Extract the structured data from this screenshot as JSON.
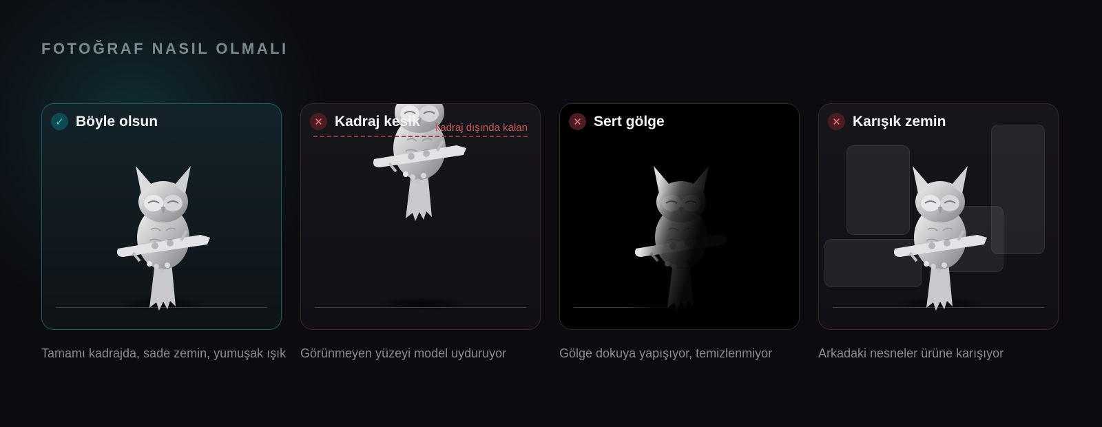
{
  "section_title": "FOTOĞRAF NASIL OLMALI",
  "cards": [
    {
      "title": "Böyle olsun",
      "caption": "Tamamı kadrajda, sade zemin, yumuşak ışık",
      "status": "ok",
      "icon": "check-icon",
      "glyph": "✓"
    },
    {
      "title": "Kadraj kesik",
      "caption": "Görünmeyen yüzeyi model uyduruyor",
      "status": "bad",
      "icon": "close-icon",
      "glyph": "✕",
      "annotation": "kadraj dışında kalan"
    },
    {
      "title": "Sert gölge",
      "caption": "Gölge dokuya yapışıyor, temizlenmiyor",
      "status": "bad",
      "icon": "close-icon",
      "glyph": "✕"
    },
    {
      "title": "Karışık zemin",
      "caption": "Arkadaki nesneler ürüne karışıyor",
      "status": "bad",
      "icon": "close-icon",
      "glyph": "✕"
    }
  ],
  "colors": {
    "ok_accent": "#4fd0d8",
    "bad_accent": "#f07b82",
    "background": "#0c0b0f"
  }
}
